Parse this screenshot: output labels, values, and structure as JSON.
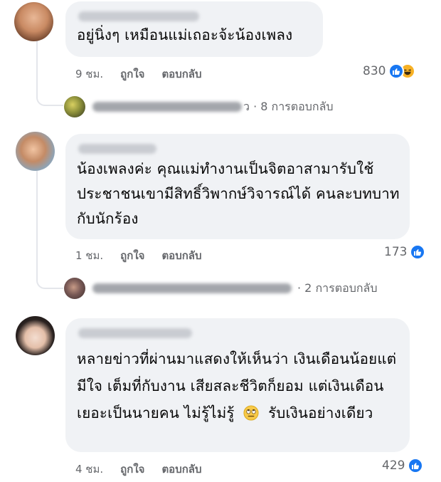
{
  "comments": [
    {
      "text": "อยู่นิ่งๆ เหมือนแม่เถอะจ้ะน้องเพลง",
      "time": "9 ชม.",
      "like_label": "ถูกใจ",
      "reply_label": "ตอบกลับ",
      "reaction_count": "830",
      "reactions": [
        "like-icon",
        "haha-icon"
      ],
      "replies": {
        "label_tail": "ว · 8 การตอบกลับ"
      }
    },
    {
      "text": "น้องเพลงค่ะ คุณแม่ทำงานเป็นจิตอาสามารับใช้ประชาชนเขามีสิทธิ์วิพากษ์วิจารณ์ได้ คนละบทบาทกับนักร้อง",
      "time": "1 ชม.",
      "like_label": "ถูกใจ",
      "reply_label": "ตอบกลับ",
      "reaction_count": "173",
      "reactions": [
        "like-icon"
      ],
      "replies": {
        "label_tail": "· 2 การตอบกลับ"
      }
    },
    {
      "text": "หลายข่าวที่ผ่านมาแสดงให้เห็นว่า เงินเดือนน้อยแต่มีใจ เต็มที่กับงาน เสียสละชีวิตก็ยอม แต่เงินเดือนเยอะเป็นนายคน ไม่รู้ไม่รู้",
      "text_after_emoji": "รับเงินอย่างเดียว",
      "emoji": "rolling-eyes-emoji",
      "time": "4 ชม.",
      "like_label": "ถูกใจ",
      "reply_label": "ตอบกลับ",
      "reaction_count": "429",
      "reactions": [
        "like-icon"
      ]
    }
  ],
  "colors": {
    "bubble": "#f0f2f5",
    "like": "#1877f2",
    "haha": "#f7b125",
    "meta": "#65676b"
  }
}
